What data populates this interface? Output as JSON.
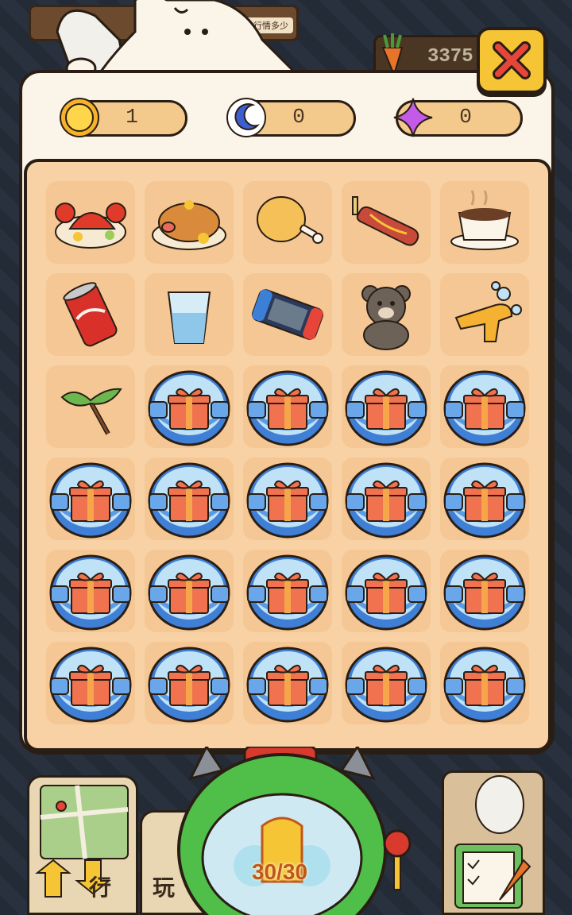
{
  "background": {
    "sign_text": "拍租金行情多少",
    "counter_value": "3375"
  },
  "currencies": [
    {
      "icon": "sun-icon",
      "value": "1"
    },
    {
      "icon": "moon-icon",
      "value": "0"
    },
    {
      "icon": "star-icon",
      "value": "0"
    }
  ],
  "grid": {
    "rows": [
      [
        "lobster-icon",
        "roast-pig-icon",
        "fried-chicken-icon",
        "sausage-icon",
        "coffee-cup-icon"
      ],
      [
        "soda-can-icon",
        "water-glass-icon",
        "game-console-icon",
        "teddy-bear-icon",
        "water-gun-icon"
      ],
      [
        "bamboo-dragonfly-icon",
        "gift-capsule-icon",
        "gift-capsule-icon",
        "gift-capsule-icon",
        "gift-capsule-icon"
      ],
      [
        "gift-capsule-icon",
        "gift-capsule-icon",
        "gift-capsule-icon",
        "gift-capsule-icon",
        "gift-capsule-icon"
      ],
      [
        "gift-capsule-icon",
        "gift-capsule-icon",
        "gift-capsule-icon",
        "gift-capsule-icon",
        "gift-capsule-icon"
      ],
      [
        "gift-capsule-icon",
        "gift-capsule-icon",
        "gift-capsule-icon",
        "gift-capsule-icon",
        "gift-capsule-icon"
      ]
    ]
  },
  "bottom": {
    "left_label": "行",
    "left_label2": "玩",
    "capsule_counter": "30/30"
  },
  "colors": {
    "panel": "#fbf4e8",
    "grid_bg": "#f8d2a4",
    "cell_bg": "#f5c794",
    "close_button": "#f5c536",
    "outline": "#2a1e14"
  }
}
